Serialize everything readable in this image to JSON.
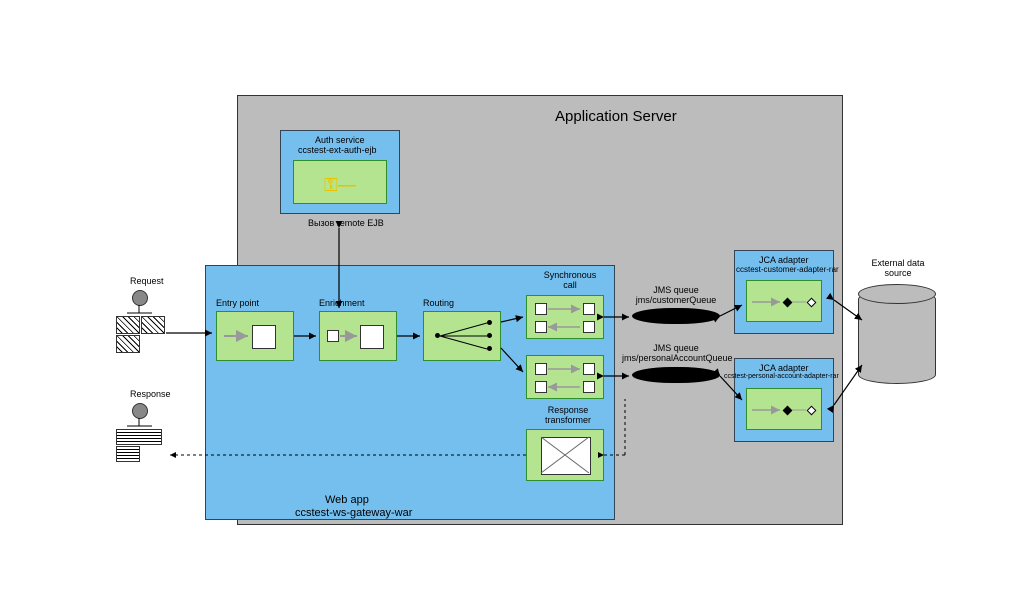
{
  "app_server": "Application Server",
  "webapp": {
    "title": "Web app",
    "name": "ccstest-ws-gateway-war"
  },
  "auth": {
    "title": "Auth service",
    "name": "ccstest-ext-auth-ejb",
    "call": "Вызов remote EJB"
  },
  "entry": "Entry point",
  "enrichment": "Enrichment",
  "routing": "Routing",
  "sync": "Synchronous call",
  "resp_trans": "Response transformer",
  "request": "Request",
  "response": "Response",
  "jms1": {
    "title": "JMS queue",
    "name": "jms/customerQueue"
  },
  "jms2": {
    "title": "JMS queue",
    "name": "jms/personalAccountQueue"
  },
  "jca1": {
    "title": "JCA adapter",
    "name": "ccstest-customer-adapter-rar"
  },
  "jca2": {
    "title": "JCA adapter",
    "name": "ccstest-personal-account-adapter-rar"
  },
  "ext": "External data source"
}
